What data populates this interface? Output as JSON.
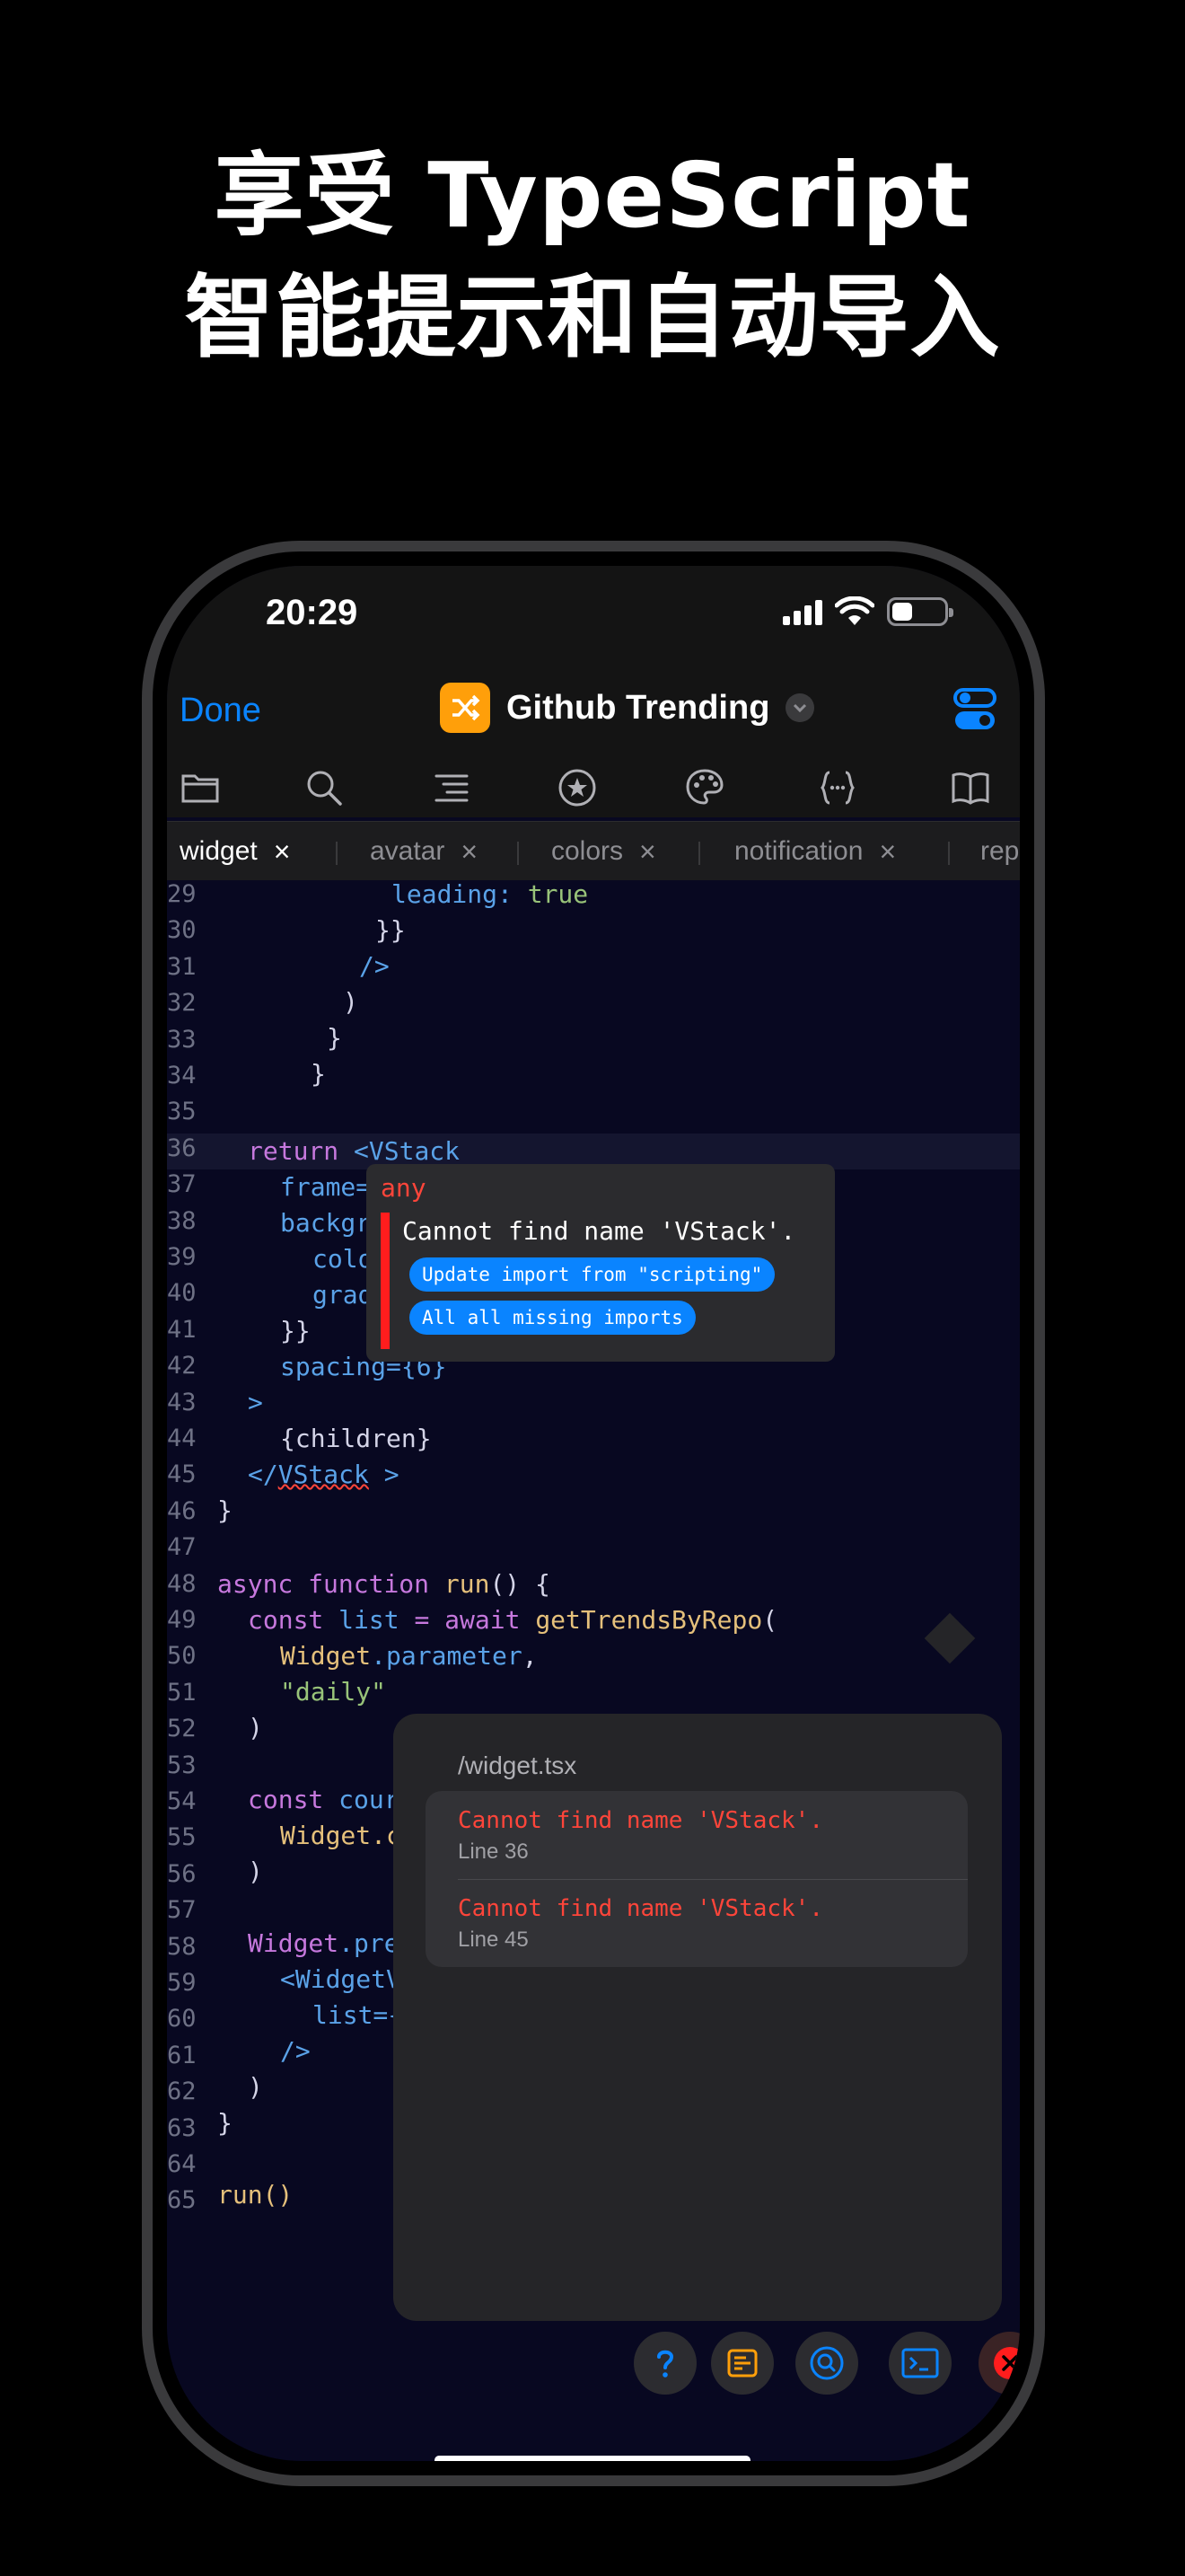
{
  "headline": {
    "line1": "享受 TypeScript",
    "line2": "智能提示和自动导入"
  },
  "status_bar": {
    "time": "20:29"
  },
  "navbar": {
    "done": "Done",
    "title": "Github Trending"
  },
  "toolbar": {
    "icons": [
      "folder-icon",
      "search-icon",
      "outline-icon",
      "star-icon",
      "palette-icon",
      "braces-icon",
      "book-icon"
    ]
  },
  "tabs": [
    {
      "label": "widget",
      "close": "×",
      "active": true
    },
    {
      "label": "avatar",
      "close": "×"
    },
    {
      "label": "colors",
      "close": "×"
    },
    {
      "label": "notification",
      "close": "×"
    },
    {
      "label": "repo"
    }
  ],
  "code": {
    "numbers": [
      "29",
      "30",
      "31",
      "32",
      "33",
      "34",
      "35",
      "36",
      "37",
      "38",
      "39",
      "40",
      "41",
      "42",
      "43",
      "44",
      "45",
      "46",
      "47",
      "48",
      "49",
      "50",
      "51",
      "52",
      "53",
      "54",
      "55",
      "56",
      "57",
      "58",
      "59",
      "60",
      "61",
      "62",
      "63",
      "64",
      "65"
    ],
    "l29": "leading:",
    "l29b": "true",
    "l30": "}}",
    "l31": "/>",
    "l32": ")",
    "l33": "}",
    "l34": "}",
    "l36a": "return",
    "l36b": "<VStack",
    "l37": "frame=",
    "l38": "backgr",
    "l39": "colo",
    "l40": "grad",
    "l41": "}}",
    "l42": "spacing={6}",
    "l43": ">",
    "l44": "{children}",
    "l45a": "</",
    "l45b": "VStack",
    "l45c": " >",
    "l46": "}",
    "l48a": "async",
    "l48b": "function",
    "l48c": "run",
    "l48d": "() {",
    "l49a": "const",
    "l49b": "list",
    "l49c": "=",
    "l49d": "await",
    "l49e": "getTrendsByRepo",
    "l49f": "(",
    "l50a": "Widget",
    "l50b": ".parameter",
    "l50c": ",",
    "l51": "\"daily\"",
    "l52": ")",
    "l54a": "const",
    "l54b": "cour",
    "l55": "Widget.c",
    "l56": ")",
    "l58a": "Widget",
    "l58b": ".pre",
    "l59": "<WidgetV",
    "l60": "list={",
    "l61": "/>",
    "l62": ")",
    "l63": "}",
    "l65": "run()"
  },
  "hover": {
    "type": "any",
    "message": "Cannot find name 'VStack'.",
    "actions": [
      "Update import from \"scripting\"",
      "All all missing imports"
    ]
  },
  "problems": {
    "path": "/widget.tsx",
    "items": [
      {
        "message": "Cannot find name 'VStack'.",
        "line": "Line 36"
      },
      {
        "message": "Cannot find name 'VStack'.",
        "line": "Line 45"
      }
    ]
  },
  "bottom_buttons": [
    "help-icon",
    "console-icon",
    "search-icon",
    "terminal-icon",
    "error-icon"
  ],
  "colors": {
    "accent": "#0a84ff",
    "error": "#ff453a",
    "app_icon": "#ff9f0a"
  }
}
